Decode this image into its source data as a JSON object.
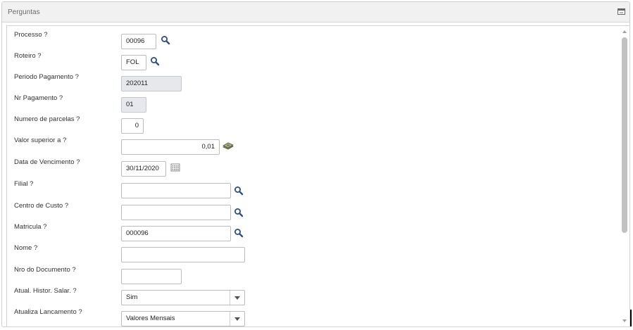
{
  "panel": {
    "title": "Perguntas"
  },
  "fields": {
    "processo": {
      "label": "Processo ?",
      "value": "00096"
    },
    "roteiro": {
      "label": "Roteiro ?",
      "value": "FOL"
    },
    "periodo_pagamento": {
      "label": "Periodo Pagamento ?",
      "value": "202011"
    },
    "nr_pagamento": {
      "label": "Nr Pagamento ?",
      "value": "01"
    },
    "numero_parcelas": {
      "label": "Numero de parcelas ?",
      "value": "0"
    },
    "valor_superior": {
      "label": "Valor superior a ?",
      "value": "0,01"
    },
    "data_vencimento": {
      "label": "Data de Vencimento ?",
      "value": "30/11/2020"
    },
    "filial": {
      "label": "Filial ?",
      "value": ""
    },
    "centro_custo": {
      "label": "Centro de Custo ?",
      "value": ""
    },
    "matricula": {
      "label": "Matricula ?",
      "value": "000096"
    },
    "nome": {
      "label": "Nome ?",
      "value": ""
    },
    "nro_documento": {
      "label": "Nro do Documento ?",
      "value": ""
    },
    "atual_histor_salar": {
      "label": "Atual. Histor. Salar. ?",
      "value": "Sim"
    },
    "atualiza_lancamento": {
      "label": "Atualiza Lancamento ?",
      "value": "Valores Mensais"
    }
  },
  "icons": {
    "lookup": "magnifier-icon",
    "currency": "money-icon",
    "calendar": "calendar-icon",
    "collapse": "collapse-panel-icon"
  }
}
